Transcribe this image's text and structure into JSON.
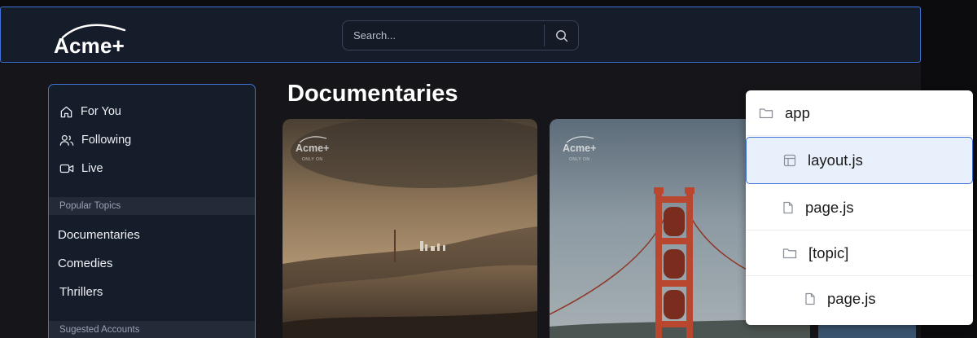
{
  "header": {
    "brand": "Acme+",
    "search": {
      "placeholder": "Search...",
      "icon": "search-icon"
    }
  },
  "sidebar": {
    "nav": [
      {
        "label": "For You",
        "icon": "home-icon"
      },
      {
        "label": "Following",
        "icon": "users-icon"
      },
      {
        "label": "Live",
        "icon": "video-icon"
      }
    ],
    "popular_topics_heading": "Popular Topics",
    "topics": [
      "Documentaries",
      "Comedies",
      "Thrillers"
    ],
    "suggested_heading": "Sugested Accounts"
  },
  "main": {
    "title": "Documentaries",
    "cards": [
      {
        "brand": "Acme+",
        "brand_sub": "ONLY ON"
      },
      {
        "brand": "Acme+",
        "brand_sub": "ONLY ON"
      }
    ]
  },
  "file_tree": {
    "items": [
      {
        "name": "app",
        "icon": "folder-icon"
      },
      {
        "name": "layout.js",
        "icon": "layout-icon",
        "selected": true
      },
      {
        "name": "page.js",
        "icon": "file-icon"
      },
      {
        "name": "[topic]",
        "icon": "folder-icon"
      },
      {
        "name": "page.js",
        "icon": "file-icon"
      }
    ]
  },
  "colors": {
    "accent_border": "#3f73d8",
    "panel_bg": "#151c2a",
    "page_bg": "#16161a",
    "selected_row_bg": "#e8f0fb"
  }
}
